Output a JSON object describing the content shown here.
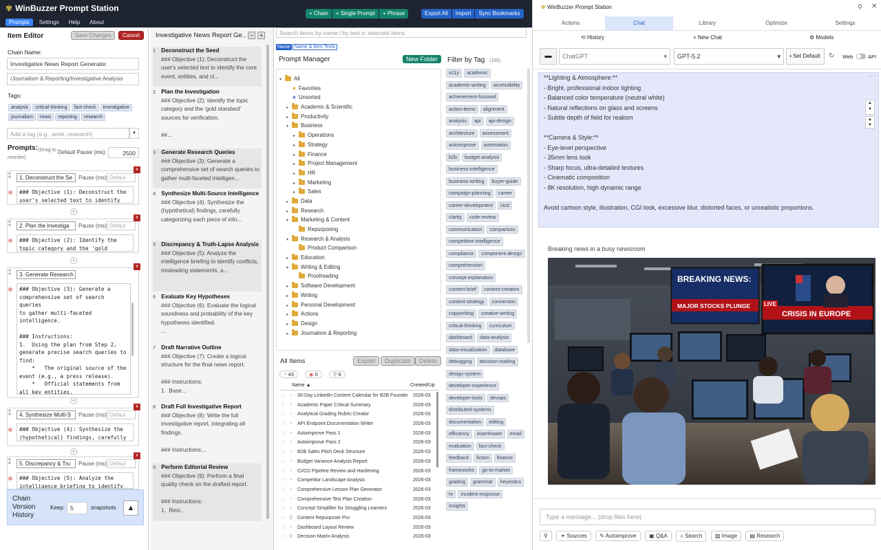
{
  "topbar": {
    "app_name": "WinBuzzer Prompt Station",
    "tabs": [
      "Prompts",
      "Settings",
      "Help",
      "About"
    ],
    "active_tab": "Prompts",
    "add_buttons": [
      "+ Chain",
      "+ Single Prompt",
      "+ Phrase"
    ],
    "actions": [
      "Export All",
      "Import",
      "Sync Bookmarks"
    ]
  },
  "editor": {
    "title": "Item Editor",
    "save_label": "Save Changes",
    "cancel_label": "Cancel",
    "chain_name_label": "Chain Name:",
    "chain_name": "Investigative News Report Generator",
    "path": "/Journalism & Reporting/Investigative Analysis",
    "tags_label": "Tags:",
    "tags": [
      "analysis",
      "critical-thinking",
      "fact-check",
      "investigative",
      "journalism",
      "news",
      "reporting",
      "research"
    ],
    "tag_placeholder": "Add a tag (e.g., work, research)",
    "prompts_label": "Prompts:",
    "drag_hint": "(Drag to reorder)",
    "default_pause_label": "Default Pause (ms):",
    "default_pause": "2500",
    "pause_label": "Pause (ms):",
    "pause_placeholder": "Defaul",
    "steps": [
      {
        "title": "1. Deconstruct the Se",
        "body": "### Objective (1): Deconstruct the\nuser's selected text to identify"
      },
      {
        "title": "2. Plan the Investiga",
        "body": "### Objective (2): Identify the\ntopic category and the 'gold"
      },
      {
        "title": "3. Generate Research",
        "body": "### Objective (3): Generate a\ncomprehensive set of search queries\nto gather multi-faceted\nintelligence.\n\n### Instructions:\n1.  Using the plan from Step 2,\ngenerate precise search queries to\nfind:\n    *   The original source of the\nevent (e.g., a press release).\n    *   Official statements from\nall key entities.\n    *   In-depth reporting from the"
      },
      {
        "title": "4. Synthesize Multi-S",
        "body": "### Objective (4): Synthesize the\n(hypothetical) findings, carefully"
      },
      {
        "title": "5. Discrepancy & Tru",
        "body": "### Objective (5): Analyze the\nintelligence briefing to identify"
      }
    ],
    "version_label": "Chain Version History",
    "keep_label": "Keep:",
    "keep_value": "5",
    "snapshots_label": "snapshots"
  },
  "steps_panel": {
    "title": "Investigative News Report Ge...",
    "items": [
      {
        "num": "1",
        "title": "Deconstruct the Seed",
        "desc": "### Objective (1): Deconstruct the user's selected text to identify the core event, entities, and cl..."
      },
      {
        "num": "2",
        "title": "Plan the Investigation",
        "desc": "### Objective (2): Identify the topic category and the 'gold standard' sources for verification.\n\n##..."
      },
      {
        "num": "3",
        "title": "Generate Research Queries",
        "desc": "### Objective (3): Generate a comprehensive set of search queries to gather multi-faceted intelligen..."
      },
      {
        "num": "4",
        "title": "Synthesize Multi-Source Intelligence",
        "desc": "### Objective (4): Synthesize the (hypothetical) findings, carefully categorizing each piece of info..."
      },
      {
        "num": "5",
        "title": "Discrepancy & Truth-Lapse Analysis",
        "desc": "### Objective (5): Analyze the intelligence briefing to identify conflicts, misleading statements, a..."
      },
      {
        "num": "6",
        "title": "Evaluate Key Hypotheses",
        "desc": "### Objective (6): Evaluate the logical soundness and probability of the key hypotheses identified.\n..."
      },
      {
        "num": "7",
        "title": "Draft Narrative Outline",
        "desc": "### Objective (7): Create a logical structure for the final news report.\n\n### Instructions:\n1.  Base..."
      },
      {
        "num": "8",
        "title": "Draft Full Investigative Report",
        "desc": "### Objective (8): Write the full investigative report, integrating all findings.\n\n### Instructions:..."
      },
      {
        "num": "9",
        "title": "Perform Editorial Review",
        "desc": "### Objective (9): Perform a final quality check on the drafted report.\n\n### Instructions:\n1.  Revi..."
      }
    ]
  },
  "manager": {
    "search_placeholder": "Search items by name / by text in selected items",
    "filter_name": "Name",
    "filter_text": "Name & Item Texts",
    "title": "Prompt Manager",
    "new_folder": "New Folder",
    "filter_tag_label": "Filter by Tag",
    "tag_count": "(186)",
    "tree": [
      {
        "label": "All",
        "depth": 0,
        "kind": "folder",
        "exp": "▾"
      },
      {
        "label": "Favorites",
        "depth": 1,
        "kind": "star",
        "exp": ""
      },
      {
        "label": "Unsorted",
        "depth": 1,
        "kind": "star2",
        "exp": ""
      },
      {
        "label": "Academic & Scientific",
        "depth": 1,
        "kind": "folder",
        "exp": "▸"
      },
      {
        "label": "Productivity",
        "depth": 1,
        "kind": "folder",
        "exp": "▸"
      },
      {
        "label": "Business",
        "depth": 1,
        "kind": "folder",
        "exp": "▾"
      },
      {
        "label": "Operations",
        "depth": 2,
        "kind": "folder",
        "exp": "▸"
      },
      {
        "label": "Strategy",
        "depth": 2,
        "kind": "folder",
        "exp": "▸"
      },
      {
        "label": "Finance",
        "depth": 2,
        "kind": "folder",
        "exp": "▸"
      },
      {
        "label": "Project Management",
        "depth": 2,
        "kind": "folder",
        "exp": "▸"
      },
      {
        "label": "HR",
        "depth": 2,
        "kind": "folder",
        "exp": "▸"
      },
      {
        "label": "Marketing",
        "depth": 2,
        "kind": "folder",
        "exp": "▸"
      },
      {
        "label": "Sales",
        "depth": 2,
        "kind": "folder",
        "exp": "▸"
      },
      {
        "label": "Data",
        "depth": 1,
        "kind": "folder",
        "exp": "▸"
      },
      {
        "label": "Research",
        "depth": 1,
        "kind": "folder",
        "exp": "▸"
      },
      {
        "label": "Marketing & Content",
        "depth": 1,
        "kind": "folder",
        "exp": "▾"
      },
      {
        "label": "Repurposing",
        "depth": 2,
        "kind": "folder",
        "exp": ""
      },
      {
        "label": "Research & Analysis",
        "depth": 1,
        "kind": "folder",
        "exp": "▾"
      },
      {
        "label": "Product Comparison",
        "depth": 2,
        "kind": "folder",
        "exp": ""
      },
      {
        "label": "Education",
        "depth": 1,
        "kind": "folder",
        "exp": "▸"
      },
      {
        "label": "Writing & Editing",
        "depth": 1,
        "kind": "folder",
        "exp": "▾"
      },
      {
        "label": "Proofreading",
        "depth": 2,
        "kind": "folder",
        "exp": ""
      },
      {
        "label": "Software Development",
        "depth": 1,
        "kind": "folder",
        "exp": "▸"
      },
      {
        "label": "Writing",
        "depth": 1,
        "kind": "folder",
        "exp": "▸"
      },
      {
        "label": "Personal Development",
        "depth": 1,
        "kind": "folder",
        "exp": "▸"
      },
      {
        "label": "Actions",
        "depth": 1,
        "kind": "folder",
        "exp": "▸"
      },
      {
        "label": "Design",
        "depth": 1,
        "kind": "folder",
        "exp": "▸"
      },
      {
        "label": "Journalism & Reporting",
        "depth": 1,
        "kind": "folder",
        "exp": "▸"
      }
    ],
    "tags": [
      "a11y",
      "academic",
      "academic-writing",
      "accessibility",
      "achievement-focused",
      "action-items",
      "alignment",
      "analysis",
      "api",
      "api-design",
      "architecture",
      "assessment",
      "autoimprove",
      "automation",
      "b2b",
      "budget-analysis",
      "business-intelligence",
      "business-writing",
      "buyer-guide",
      "campaign-planning",
      "career",
      "career-development",
      "cicd",
      "clarity",
      "code-review",
      "communication",
      "comparison",
      "competitive-intelligence",
      "compliance",
      "component-design",
      "comprehension",
      "concept-explanation",
      "content-brief",
      "content-creation",
      "content-strategy",
      "conversion",
      "copywriting",
      "creative-writing",
      "critical-thinking",
      "curriculum",
      "dashboard",
      "data-analysis",
      "data-visualization",
      "database",
      "debugging",
      "decision-making",
      "design-system",
      "developer-experience",
      "developer-tools",
      "devops",
      "distributed-systems",
      "documentation",
      "editing",
      "efficiency",
      "eisenhower",
      "email",
      "evaluation",
      "fact-check",
      "feedback",
      "fiction",
      "finance",
      "frameworks",
      "go-to-market",
      "grading",
      "grammar",
      "heuristics",
      "hr",
      "incident-response",
      "insights"
    ],
    "all_items_label": "All Items",
    "export_label": "Export",
    "duplicate_label": "Duplicate",
    "delete_label": "Delete",
    "counts": {
      "prompts": "43",
      "chains": "0",
      "phrases": "6"
    },
    "col_name": "Name",
    "col_created": "Created/Up",
    "items": [
      {
        "name": "30-Day LinkedIn Content Calendar for B2B Founders",
        "date": "2026-03"
      },
      {
        "name": "Academic Paper Critical Summary",
        "date": "2026-03"
      },
      {
        "name": "Analytical Grading Rubric Creator",
        "date": "2026-03"
      },
      {
        "name": "API Endpoint Documentation Writer",
        "date": "2026-03"
      },
      {
        "name": "Autoimprove Pass 1",
        "date": "2026-03"
      },
      {
        "name": "Autoimprove Pass 2",
        "date": "2026-03"
      },
      {
        "name": "B2B Sales Pitch Deck Structure",
        "date": "2026-03"
      },
      {
        "name": "Budget Variance Analysis Report",
        "date": "2026-03"
      },
      {
        "name": "CI/CD Pipeline Review and Hardening",
        "date": "2026-03"
      },
      {
        "name": "Competitor Landscape Analysis",
        "date": "2026-03"
      },
      {
        "name": "Comprehensive Lesson Plan Generator",
        "date": "2026-03"
      },
      {
        "name": "Comprehensive Test Plan Creation",
        "date": "2026-03"
      },
      {
        "name": "Concept Simplifier for Struggling Learners",
        "date": "2026-03"
      },
      {
        "name": "Content Repurposer Pro",
        "date": "2026-03"
      },
      {
        "name": "Dashboard Layout Review",
        "date": "2026-03"
      },
      {
        "name": "Decision Matrix Analysis",
        "date": "2026-03"
      }
    ]
  },
  "side": {
    "title": "WinBuzzer Prompt Station",
    "tabs": [
      "Actions",
      "Chat",
      "Library",
      "Optimize",
      "Settings"
    ],
    "active_tab": "Chat",
    "history_label": "History",
    "new_chat_label": "+ New Chat",
    "models_label": "Models",
    "provider": "ChatGPT",
    "model": "GPT-5.2",
    "set_default": "Set Default",
    "web_label": "Web",
    "api_label": "API",
    "chat_text": "**Lighting & Atmosphere:**\n- Bright, professional indoor lighting\n- Balanced color temperature (neutral white)\n- Natural reflections on glass and screens\n- Subtle depth of field for realism\n\n**Camera & Style:**\n- Eye-level perspective\n- 35mm lens look\n- Sharp focus, ultra-detailed textures\n- Cinematic composition\n- 8K resolution, high dynamic range\n\nAvoid cartoon style, illustration, CGI look, excessive blur, distorted faces, or unrealistic proportions.",
    "image_caption": "Breaking news in a busy newsroom",
    "screen1_title": "BREAKING NEWS:",
    "screen1_sub": "MAJOR STOCKS PLUNGE",
    "screen2_live": "LIVE",
    "screen2_title": "CRISIS IN EUROPE",
    "msg_placeholder": "Type a message... (drop files here)",
    "bottom_buttons": [
      "Sources",
      "Autoimprove",
      "Q&A",
      "Search",
      "Image",
      "Research"
    ]
  },
  "colors": {
    "topbar": "#1e2430",
    "accent": "#3b82f6",
    "green": "#13836b",
    "blue": "#2563c9",
    "red": "#b32424",
    "chat_bg": "#e5e8fb"
  }
}
